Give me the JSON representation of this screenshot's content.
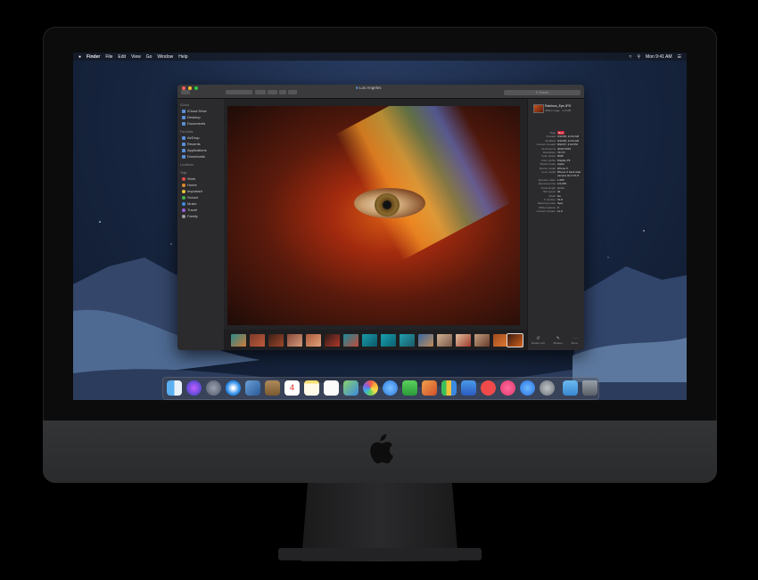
{
  "menubar": {
    "apple": "",
    "app": "Finder",
    "items": [
      "File",
      "Edit",
      "View",
      "Go",
      "Window",
      "Help"
    ],
    "clock": "Mon 9:41 AM"
  },
  "window": {
    "title": "Los Angeles",
    "search_placeholder": "Search",
    "sidebar": {
      "sections": [
        {
          "heading": "iCloud",
          "items": [
            "iCloud Drive",
            "Desktop",
            "Documents"
          ]
        },
        {
          "heading": "Favorites",
          "items": [
            "AirDrop",
            "Recents",
            "Applications",
            "Downloads"
          ]
        },
        {
          "heading": "Locations",
          "items": []
        },
        {
          "heading": "Tags",
          "items": [
            "Work",
            "Home",
            "Important",
            "School",
            "Music",
            "Travel",
            "Family"
          ]
        }
      ],
      "tag_colors": [
        "#e24b4b",
        "#e0882b",
        "#e7c43a",
        "#3fb34b",
        "#3f8ce0",
        "#9a5ed8",
        "#9a9aa0"
      ]
    },
    "inspector": {
      "filename": "Rainbow_Eye.JPG",
      "kind": "JPEG image · 2.6 MB",
      "rows": [
        {
          "k": "Tags",
          "v": "Red"
        },
        {
          "k": "Created",
          "v": "3/12/18, 11:04 AM"
        },
        {
          "k": "Modified",
          "v": "3/12/18, 11:04 AM"
        },
        {
          "k": "Content created",
          "v": "8/22/17, 4:02 PM"
        },
        {
          "k": "Dimensions",
          "v": "4032×3024"
        },
        {
          "k": "Resolution",
          "v": "72×72"
        },
        {
          "k": "Color space",
          "v": "RGB"
        },
        {
          "k": "Color profile",
          "v": "Display P3"
        },
        {
          "k": "Device make",
          "v": "Apple"
        },
        {
          "k": "Device model",
          "v": "iPhone X"
        },
        {
          "k": "Lens model",
          "v": "iPhone X back dual"
        },
        {
          "k": "",
          "v": "camera 4mm f/1.8"
        },
        {
          "k": "Aperture value",
          "v": "1.695"
        },
        {
          "k": "Exposure time",
          "v": "1/2,183"
        },
        {
          "k": "Focal length",
          "v": "4 mm"
        },
        {
          "k": "ISO speed",
          "v": "32"
        },
        {
          "k": "Flash",
          "v": "No"
        },
        {
          "k": "F number",
          "v": "f/1.8"
        },
        {
          "k": "Metering mode",
          "v": "Spot"
        },
        {
          "k": "White balance",
          "v": "0"
        },
        {
          "k": "Content Creator",
          "v": "11.0"
        }
      ],
      "actions": [
        "Rotate Left",
        "Markup",
        "More..."
      ]
    }
  }
}
